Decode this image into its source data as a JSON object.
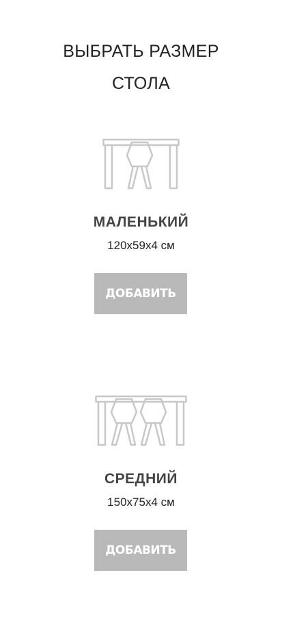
{
  "header": {
    "title_line1": "ВЫБРАТЬ РАЗМЕР",
    "title_line2": "СТОЛА"
  },
  "options": [
    {
      "name": "МАЛЕНЬКИЙ",
      "size": "120x59x4 см",
      "button_label": "ДОБАВИТЬ",
      "icon": "table-one-chair-icon"
    },
    {
      "name": "СРЕДНИЙ",
      "size": "150x75x4 см",
      "button_label": "ДОБАВИТЬ",
      "icon": "table-two-chairs-icon"
    }
  ],
  "colors": {
    "button_bg": "#b9b9b9",
    "icon_stroke": "#c8c8c8",
    "title": "#222222",
    "option_name": "#444444"
  }
}
